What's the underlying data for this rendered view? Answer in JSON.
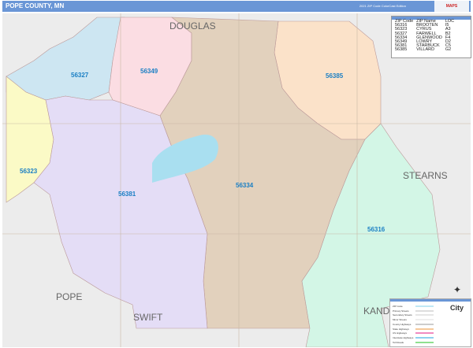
{
  "header": {
    "title": "POPE COUNTY, MN",
    "edition": "2021 ZIP Code ColorCast Edition",
    "logo": "Market MAPS"
  },
  "counties": [
    "DOUGLAS",
    "STEARNS",
    "POPE",
    "SWIFT",
    "KANDI"
  ],
  "zip_areas": [
    {
      "zip": "56327",
      "color": "#cde6f2"
    },
    {
      "zip": "56349",
      "color": "#fbdde3"
    },
    {
      "zip": "56385",
      "color": "#fbe2c9"
    },
    {
      "zip": "56334",
      "color": "#e2d1bd"
    },
    {
      "zip": "56323",
      "color": "#fbfac6"
    },
    {
      "zip": "56381",
      "color": "#e4ddf6"
    },
    {
      "zip": "56316",
      "color": "#d3f6e6"
    }
  ],
  "zip_legend": {
    "headers": [
      "ZIP Code",
      "ZIP Name",
      "LOC"
    ],
    "rows": [
      [
        "56316",
        "BROOTEN",
        "I5"
      ],
      [
        "56323",
        "CYRUS",
        "A3"
      ],
      [
        "56327",
        "FARWELL",
        "B2"
      ],
      [
        "56334",
        "GLENWOOD",
        "F4"
      ],
      [
        "56349",
        "LOWRY",
        "D2"
      ],
      [
        "56381",
        "STARBUCK",
        "C5"
      ],
      [
        "56385",
        "VILLARD",
        "G2"
      ]
    ]
  },
  "map_legend": {
    "items": [
      {
        "label": "ZIP Code",
        "color": "#bfe8f5"
      },
      {
        "label": "Primary Streets",
        "color": "#dddddd"
      },
      {
        "label": "Secondary Streets",
        "color": "#e6e6e6"
      },
      {
        "label": "Minor Streets",
        "color": "#eeeeee"
      },
      {
        "label": "County Highways",
        "color": "#cccccc"
      },
      {
        "label": "State Highways",
        "color": "#f5c89a"
      },
      {
        "label": "US Highways",
        "color": "#f08ac0"
      },
      {
        "label": "Interstate Highways",
        "color": "#8fd0f0"
      },
      {
        "label": "Toll Roads",
        "color": "#8fe08f"
      }
    ],
    "city": "City"
  }
}
